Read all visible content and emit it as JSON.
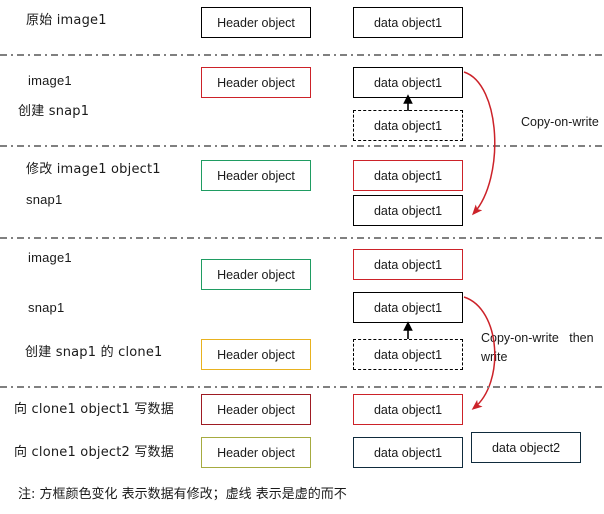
{
  "diagram": {
    "title": "Copy-on-write image / snapshot / clone diagram",
    "colors": {
      "black": "#000000",
      "red": "#cc2229",
      "green": "#1f9c62",
      "gold": "#e8b21f",
      "dark_red": "#9e1b23",
      "olive": "#a6ab40",
      "navy": "#0f2b3d",
      "divider": "#808080",
      "arrow_red": "#cc2229"
    },
    "sections": [
      {
        "id": "section-1",
        "labels": [
          {
            "text": "原始 image1"
          }
        ],
        "header_box": {
          "text": "Header object",
          "border": "solid",
          "color": "#000000"
        },
        "data_boxes": [
          {
            "text": "data object1",
            "border": "solid",
            "color": "#000000"
          }
        ]
      },
      {
        "id": "section-2",
        "labels": [
          {
            "text": "image1"
          },
          {
            "text": "创建 snap1"
          }
        ],
        "header_box": {
          "text": "Header object",
          "border": "solid",
          "color": "#cc2229"
        },
        "data_boxes": [
          {
            "text": "data object1",
            "border": "solid",
            "color": "#000000"
          },
          {
            "text": "data object1",
            "border": "dashed",
            "color": "#000000"
          }
        ],
        "annotation": "Copy-on-write"
      },
      {
        "id": "section-3",
        "labels": [
          {
            "text": "修改 image1 object1"
          },
          {
            "text": "snap1"
          }
        ],
        "header_box": {
          "text": "Header object",
          "border": "solid",
          "color": "#1f9c62"
        },
        "data_boxes": [
          {
            "text": "data object1",
            "border": "solid",
            "color": "#cc2229"
          },
          {
            "text": "data object1",
            "border": "solid",
            "color": "#000000"
          }
        ]
      },
      {
        "id": "section-4",
        "labels": [
          {
            "text": "image1"
          },
          {
            "text": "snap1"
          },
          {
            "text": "创建 snap1 的 clone1"
          }
        ],
        "header_boxes": [
          {
            "text": "Header object",
            "border": "solid",
            "color": "#1f9c62"
          },
          {
            "text": "Header object",
            "border": "solid",
            "color": "#e8b21f"
          }
        ],
        "data_boxes": [
          {
            "text": "data object1",
            "border": "solid",
            "color": "#cc2229"
          },
          {
            "text": "data object1",
            "border": "solid",
            "color": "#000000"
          },
          {
            "text": "data object1",
            "border": "dashed",
            "color": "#000000"
          }
        ],
        "annotation_line1": "Copy-on-write   then",
        "annotation_line2": "write"
      },
      {
        "id": "section-5",
        "labels": [
          {
            "text": "向 clone1 object1 写数据"
          },
          {
            "text": "向 clone1 object2 写数据"
          }
        ],
        "header_boxes": [
          {
            "text": "Header object",
            "border": "solid",
            "color": "#9e1b23"
          },
          {
            "text": "Header object",
            "border": "solid",
            "color": "#a6ab40"
          }
        ],
        "data_boxes": [
          {
            "text": "data object1",
            "border": "solid",
            "color": "#cc2229"
          },
          {
            "text": "data object1",
            "border": "solid",
            "color": "#0f2b3d"
          },
          {
            "text": "data object2",
            "border": "solid",
            "color": "#0f2b3d"
          }
        ]
      }
    ],
    "footer_note": "注: 方框颜色变化 表示数据有修改；虚线 表示是虚的而不"
  }
}
